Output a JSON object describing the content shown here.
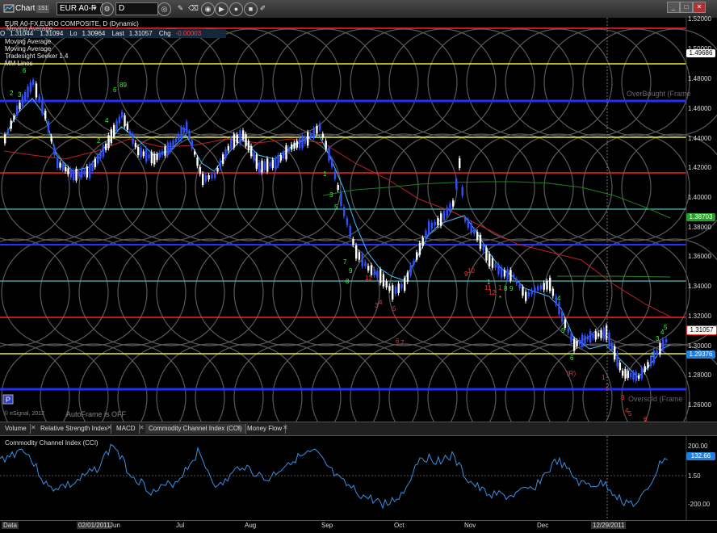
{
  "toolbar": {
    "chart_label": "Chart",
    "chart_tag": "1S1",
    "symbol": "EUR A0-F",
    "interval": "D",
    "icons": [
      "link-icon",
      "refresh-icon",
      "pencil-icon",
      "eraser-icon",
      "play-icon",
      "circle-icon",
      "draw-icon"
    ]
  },
  "legend": {
    "symbol_line": "EUR A0-FX,EURO COMPOSITE, D (Dynamic)",
    "studies": [
      "Moving Average",
      "Moving Average",
      "Moving Average",
      "Tradesight Seeker 1.4",
      "MM Lines"
    ]
  },
  "quote": {
    "open_label": "O",
    "open": "1.31044",
    "high": "1.31094",
    "low_label": "Lo",
    "low": "1.30964",
    "last_label": "Last",
    "last": "1.31057",
    "chg_label": "Chg",
    "chg": "-0.00003"
  },
  "price_axis": {
    "labels": [
      "1.52000",
      "1.50000",
      "1.48000",
      "1.46000",
      "1.44000",
      "1.42000",
      "1.40000",
      "1.38000",
      "1.36000",
      "1.34000",
      "1.32000",
      "1.30000",
      "1.28000",
      "1.26000"
    ],
    "tags": {
      "top": "1.49686",
      "mid": "1.38703",
      "last": "1.31057",
      "low": "1.29376"
    }
  },
  "overlays": {
    "overbought": "OverBought (Frame",
    "oversold": "Oversold (Frame",
    "autoframe": "AutoFrame is OFF",
    "esignal": "© eSignal, 2012",
    "p_button": "P"
  },
  "tabs": [
    "Volume",
    "Relative Strength Index",
    "MACD",
    "Commodity Channel Index (CCI)",
    "Money Flow"
  ],
  "cci": {
    "title": "Commodity Channel Index (CCI)",
    "axis": [
      "200.00",
      "1.50",
      "-200.00"
    ],
    "value": "132.66"
  },
  "time_axis": {
    "labels": [
      "Jun",
      "Jul",
      "Aug",
      "Sep",
      "Oct",
      "Nov",
      "Dec"
    ],
    "cursor_date": "12/29/2011",
    "left_date": "02/01/2011",
    "data_label": "Data"
  },
  "colors": {
    "red_line": "#ff2020",
    "yellow_line": "#f0f030",
    "blue_line": "#2030ff",
    "teal_line": "#40a0a0",
    "candle_up": "#ffffff",
    "candle_down": "#3050ff",
    "cci_line": "#3a8fe0"
  }
}
